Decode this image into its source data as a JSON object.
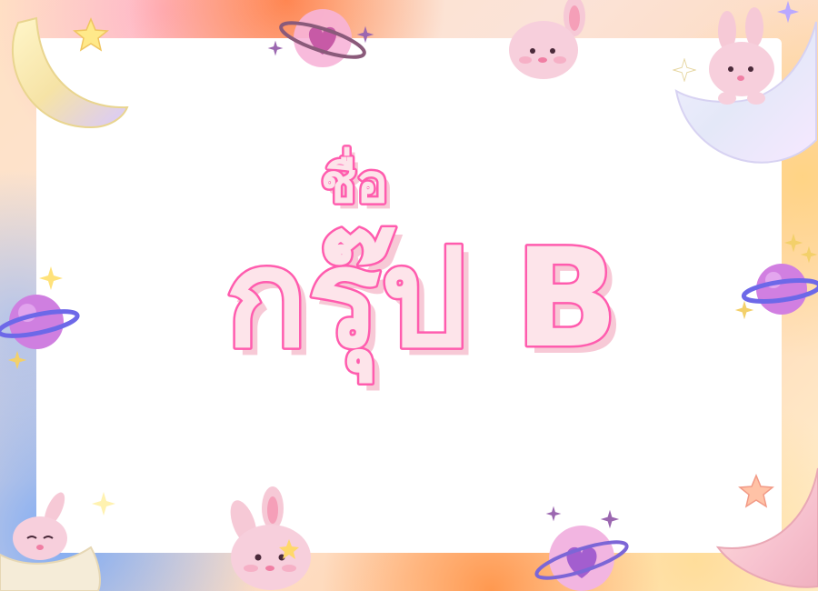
{
  "title": {
    "top_line": "ชื่อ",
    "main_line": "กรุ๊ป B",
    "fill_color": "#fde4ea",
    "stroke_color": "#ff5cae"
  },
  "decorations": [
    "crescent-moon-icon",
    "star-icon",
    "planet-icon",
    "heart-planet-icon",
    "bunny-head-icon",
    "bunny-on-moon-icon",
    "sparkle-icon"
  ]
}
